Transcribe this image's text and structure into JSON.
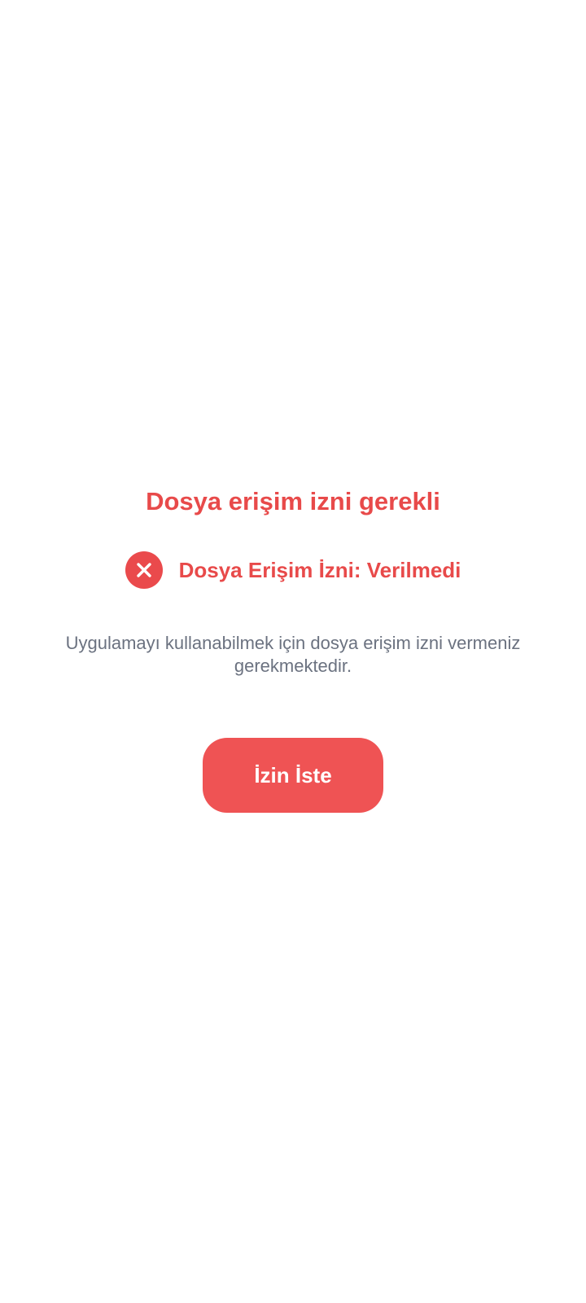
{
  "screen": {
    "title": "Dosya erişim izni gerekli",
    "status": {
      "icon": "close-icon",
      "label": "Dosya Erişim İzni: Verilmedi",
      "color": "#ea4a4c"
    },
    "description": "Uygulamayı kullanabilmek için dosya erişim izni vermeniz gerekmektedir.",
    "request_button_label": "İzin İste"
  },
  "colors": {
    "accent": "#e84a4a",
    "button": "#ef5354",
    "description_text": "#6b7280",
    "background": "#ffffff"
  }
}
